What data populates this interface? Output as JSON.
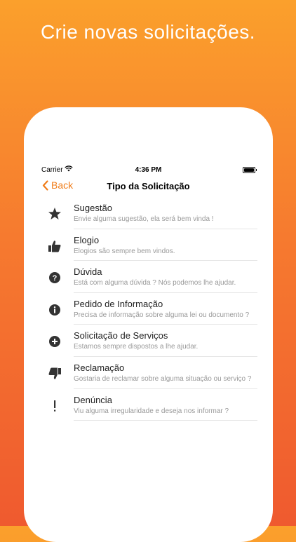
{
  "headline": "Crie novas solicitações.",
  "status": {
    "carrier": "Carrier",
    "time": "4:36 PM"
  },
  "nav": {
    "back_label": "Back",
    "title": "Tipo da Solicitação",
    "accent": "#f07d1a"
  },
  "items": [
    {
      "title": "Sugestão",
      "subtitle": "Envie alguma sugestão, ela será bem vinda !",
      "icon": "star-icon"
    },
    {
      "title": "Elogio",
      "subtitle": "Elogios são sempre bem vindos.",
      "icon": "thumbs-up-icon"
    },
    {
      "title": "Dúvida",
      "subtitle": "Está com alguma dúvida ? Nós podemos lhe ajudar.",
      "icon": "question-icon"
    },
    {
      "title": "Pedido de Informação",
      "subtitle": "Precisa de informação sobre alguma lei ou documento ?",
      "icon": "info-icon"
    },
    {
      "title": "Solicitação de Serviços",
      "subtitle": "Estamos sempre dispostos a lhe ajudar.",
      "icon": "plus-circle-icon"
    },
    {
      "title": "Reclamação",
      "subtitle": "Gostaria de reclamar sobre alguma situação ou serviço ?",
      "icon": "thumbs-down-icon"
    },
    {
      "title": "Denúncia",
      "subtitle": "Viu alguma irregularidade e deseja nos informar ?",
      "icon": "exclamation-icon"
    }
  ]
}
